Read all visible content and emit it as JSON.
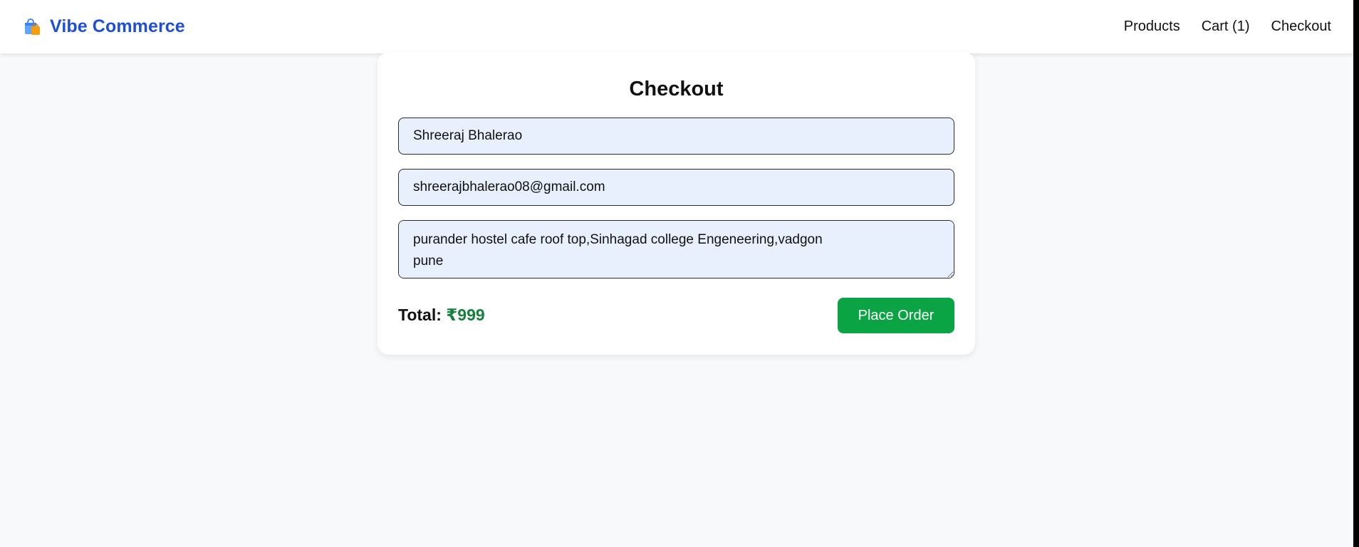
{
  "navbar": {
    "brand_icon": "shopping-bags-icon",
    "brand_name": "Vibe Commerce",
    "links": [
      {
        "label": "Products"
      },
      {
        "label": "Cart (1)"
      },
      {
        "label": "Checkout"
      }
    ]
  },
  "checkout": {
    "title": "Checkout",
    "name_value": "Shreeraj Bhalerao",
    "email_value": "shreerajbhalerao08@gmail.com",
    "address_value": "purander hostel cafe roof top,Sinhagad college Engeneering,vadgon\npune",
    "total_label": "Total:",
    "total_amount": "₹999",
    "place_order_label": "Place Order"
  },
  "colors": {
    "brand": "#1d4ed8",
    "total_amount": "#15803d",
    "place_order_button": "#0aa444",
    "input_background": "#e8f0fe",
    "page_background": "#f8f9fb"
  }
}
